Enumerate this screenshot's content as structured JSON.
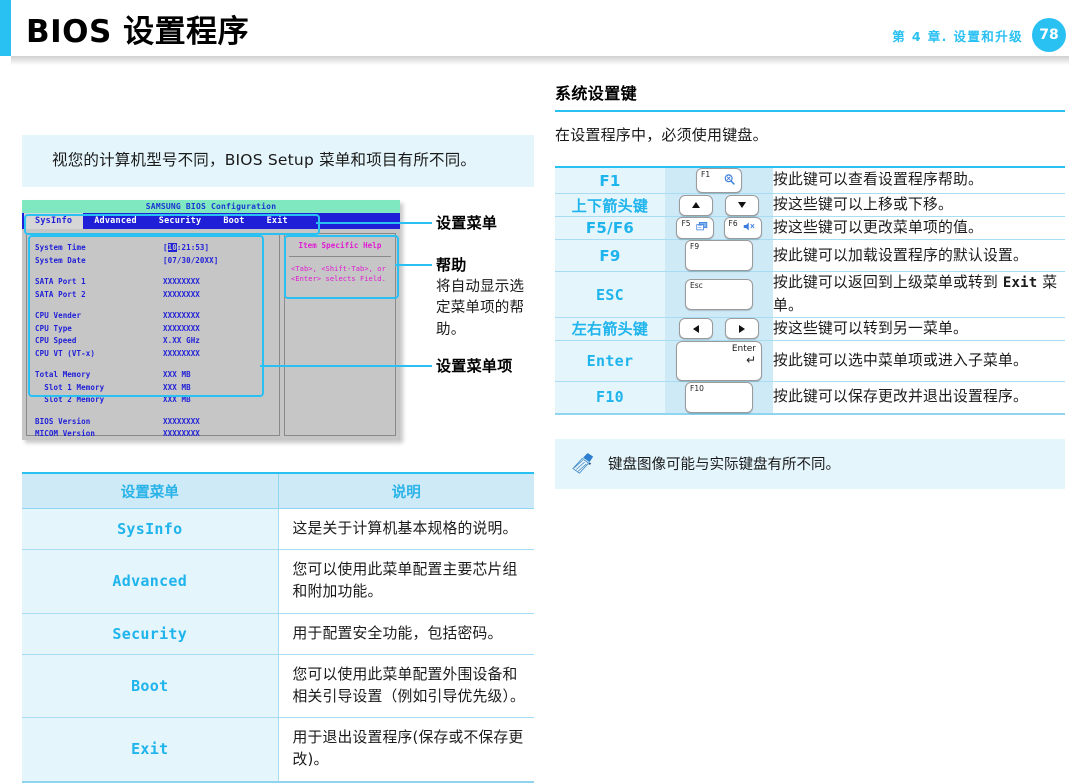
{
  "header": {
    "title": "BIOS 设置程序",
    "chapter": "第 4 章. 设置和升级",
    "page_number": "78",
    "accent_color": "#29c0f2"
  },
  "left": {
    "note": "视您的计算机型号不同，BIOS Setup 菜单和项目有所不同。",
    "bios_screen": {
      "window_title": "SAMSUNG BIOS Configuration",
      "menu_tabs": [
        "SysInfo",
        "Advanced",
        "Security",
        "Boot",
        "Exit"
      ],
      "active_tab": "SysInfo",
      "help_panel": {
        "title": "Item Specific Help",
        "text": "<Tab>, <Shift-Tab>, or <Enter> selects Field."
      },
      "fields": [
        {
          "label": "System Time",
          "value": "[10:21:53]",
          "highlight": "10"
        },
        {
          "label": "System Date",
          "value": "[07/30/20XX]"
        },
        {
          "label": "SATA Port 1",
          "value": "XXXXXXXX"
        },
        {
          "label": "SATA Port 2",
          "value": "XXXXXXXX"
        },
        {
          "label": "CPU Vender",
          "value": "XXXXXXXX"
        },
        {
          "label": "CPU Type",
          "value": "XXXXXXXX"
        },
        {
          "label": "CPU Speed",
          "value": "X.XX GHz"
        },
        {
          "label": "CPU VT (VT-x)",
          "value": "XXXXXXXX"
        },
        {
          "label": "Total Memory",
          "value": "XXX MB"
        },
        {
          "label": "  Slot 1 Memory",
          "value": "XXX MB"
        },
        {
          "label": "  Slot 2 Memory",
          "value": "XXX MB"
        },
        {
          "label": "BIOS Version",
          "value": "XXXXXXXX"
        },
        {
          "label": "MICOM Version",
          "value": "XXXXXXXX"
        }
      ]
    },
    "callouts": {
      "menu": "设置菜单",
      "help_title": "帮助",
      "help_desc": "将自动显示选定菜单项的帮助。",
      "items": "设置菜单项"
    },
    "menu_table": {
      "headers": [
        "设置菜单",
        "说明"
      ],
      "rows": [
        {
          "name": "SysInfo",
          "desc": "这是关于计算机基本规格的说明。"
        },
        {
          "name": "Advanced",
          "desc": "您可以使用此菜单配置主要芯片组和附加功能。"
        },
        {
          "name": "Security",
          "desc": "用于配置安全功能，包括密码。"
        },
        {
          "name": "Boot",
          "desc": "您可以使用此菜单配置外围设备和相关引导设置（例如引导优先级）。"
        },
        {
          "name": "Exit",
          "desc": "用于退出设置程序(保存或不保存更改)。"
        }
      ]
    }
  },
  "right": {
    "section_title": "系统设置键",
    "section_lead": "在设置程序中，必须使用键盘。",
    "key_rows": [
      {
        "name": "F1",
        "name_mono": false,
        "keys": [
          {
            "type": "fn",
            "label": "F1",
            "glyph": "help-icon"
          }
        ],
        "desc": "按此键可以查看设置程序帮助。"
      },
      {
        "name": "上下箭头键",
        "name_mono": false,
        "keys": [
          {
            "type": "arrow",
            "glyph": "arrow-up-icon"
          },
          {
            "type": "arrow",
            "glyph": "arrow-down-icon"
          }
        ],
        "desc": "按这些键可以上移或下移。"
      },
      {
        "name": "F5/F6",
        "name_mono": false,
        "keys": [
          {
            "type": "fn",
            "label": "F5",
            "glyph": "display-switch-icon"
          },
          {
            "type": "fn",
            "label": "F6",
            "glyph": "mute-icon"
          }
        ],
        "desc": "按这些键可以更改菜单项的值。"
      },
      {
        "name": "F9",
        "name_mono": false,
        "keys": [
          {
            "type": "fn-wide",
            "label": "F9"
          }
        ],
        "desc": "按此键可以加载设置程序的默认设置。"
      },
      {
        "name": "ESC",
        "name_mono": true,
        "keys": [
          {
            "type": "fn-wide",
            "label": "Esc"
          }
        ],
        "desc_pre": "按此键可以返回到上级菜单或转到 ",
        "desc_mono": "Exit",
        "desc_post": " 菜单。"
      },
      {
        "name": "左右箭头键",
        "name_mono": false,
        "keys": [
          {
            "type": "arrow",
            "glyph": "arrow-left-icon"
          },
          {
            "type": "arrow",
            "glyph": "arrow-right-icon"
          }
        ],
        "desc": "按这些键可以转到另一菜单。"
      },
      {
        "name": "Enter",
        "name_mono": true,
        "keys": [
          {
            "type": "enter",
            "label": "Enter",
            "glyph": "enter-arrow-icon"
          }
        ],
        "desc": "按此键可以选中菜单项或进入子菜单。"
      },
      {
        "name": "F10",
        "name_mono": true,
        "keys": [
          {
            "type": "fn-wide",
            "label": "F10"
          }
        ],
        "desc": "按此键可以保存更改并退出设置程序。"
      }
    ],
    "note": "键盘图像可能与实际键盘有所不同。"
  }
}
